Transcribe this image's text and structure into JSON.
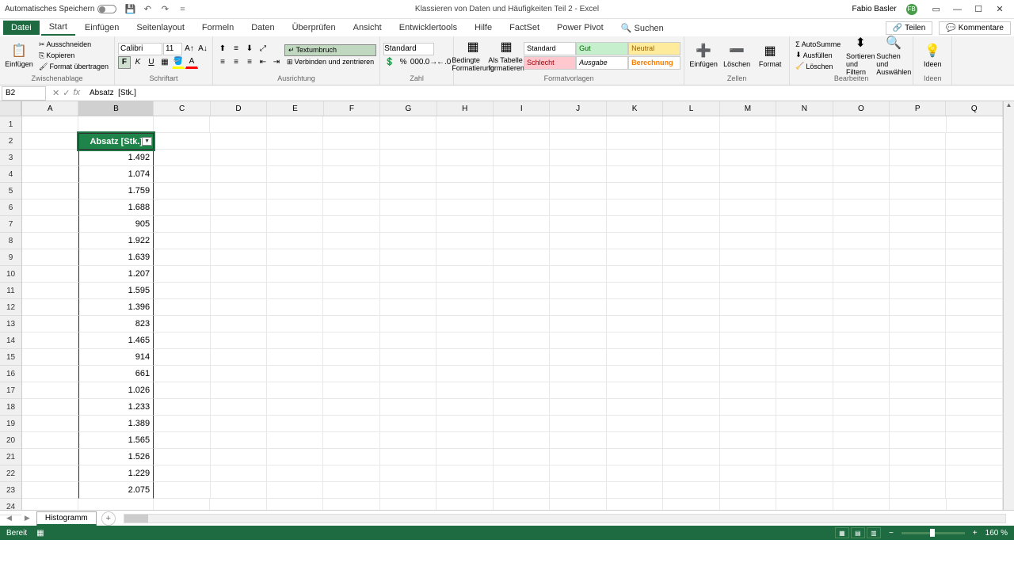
{
  "titlebar": {
    "autosave": "Automatisches Speichern",
    "document": "Klassieren von Daten und Häufigkeiten Teil 2 - Excel",
    "user": "Fabio Basler",
    "initials": "FB"
  },
  "tabs": {
    "file": "Datei",
    "start": "Start",
    "einfugen": "Einfügen",
    "seitenlayout": "Seitenlayout",
    "formeln": "Formeln",
    "daten": "Daten",
    "uberprufen": "Überprüfen",
    "ansicht": "Ansicht",
    "entwicklertools": "Entwicklertools",
    "hilfe": "Hilfe",
    "factset": "FactSet",
    "powerpivot": "Power Pivot",
    "suchen": "Suchen",
    "teilen": "Teilen",
    "kommentare": "Kommentare"
  },
  "ribbon": {
    "clipboard": {
      "einfugen": "Einfügen",
      "ausschneiden": "Ausschneiden",
      "kopieren": "Kopieren",
      "format_ubertragen": "Format übertragen",
      "label": "Zwischenablage"
    },
    "font": {
      "name": "Calibri",
      "size": "11",
      "label": "Schriftart"
    },
    "alignment": {
      "textumbruch": "Textumbruch",
      "verbinden": "Verbinden und zentrieren",
      "label": "Ausrichtung"
    },
    "number": {
      "format": "Standard",
      "label": "Zahl"
    },
    "styles": {
      "bedingte": "Bedingte Formatierung",
      "als_tabelle": "Als Tabelle formatieren",
      "standard": "Standard",
      "gut": "Gut",
      "neutral": "Neutral",
      "schlecht": "Schlecht",
      "ausgabe": "Ausgabe",
      "berechnung": "Berechnung",
      "label": "Formatvorlagen"
    },
    "cells": {
      "einfugen": "Einfügen",
      "loschen": "Löschen",
      "format": "Format",
      "label": "Zellen"
    },
    "editing": {
      "autosumme": "AutoSumme",
      "ausfullen": "Ausfüllen",
      "loschen": "Löschen",
      "sortieren": "Sortieren und Filtern",
      "suchen": "Suchen und Auswählen",
      "label": "Bearbeiten"
    },
    "ideas": {
      "ideen": "Ideen",
      "label": "Ideen"
    }
  },
  "formula": {
    "cell_ref": "B2",
    "value": "Absatz  [Stk.]"
  },
  "columns": [
    "A",
    "B",
    "C",
    "D",
    "E",
    "F",
    "G",
    "H",
    "I",
    "J",
    "K",
    "L",
    "M",
    "N",
    "O",
    "P",
    "Q"
  ],
  "rows": [
    "1",
    "2",
    "3",
    "4",
    "5",
    "6",
    "7",
    "8",
    "9",
    "10",
    "11",
    "12",
    "13",
    "14",
    "15",
    "16",
    "17",
    "18",
    "19",
    "20",
    "21",
    "22",
    "23",
    "24"
  ],
  "table": {
    "header": "Absatz  [Stk.]",
    "data": [
      "1.492",
      "1.074",
      "1.759",
      "1.688",
      "905",
      "1.922",
      "1.639",
      "1.207",
      "1.595",
      "1.396",
      "823",
      "1.465",
      "914",
      "661",
      "1.026",
      "1.233",
      "1.389",
      "1.565",
      "1.526",
      "1.229",
      "2.075"
    ]
  },
  "sheet": {
    "name": "Histogramm"
  },
  "status": {
    "ready": "Bereit",
    "zoom": "160 %"
  }
}
